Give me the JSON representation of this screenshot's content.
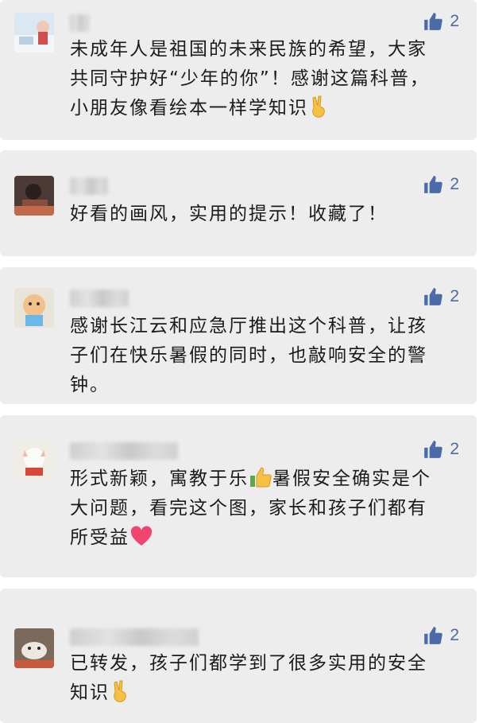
{
  "comments": [
    {
      "like_count": "2",
      "lines": [
        "未成年人是祖国的未来民族的希望，大家",
        "共同守护好“少年的你”！感谢这篇科普，",
        "小朋友像看绘本一样学知识"
      ],
      "trailing_emoji": "victory-hand-emoji"
    },
    {
      "like_count": "2",
      "lines": [
        "好看的画风，实用的提示！收藏了！"
      ]
    },
    {
      "like_count": "2",
      "lines": [
        "感谢长江云和应急厅推出这个科普，让孩",
        "子们在快乐暑假的同时，也敲响安全的警",
        "钟。"
      ]
    },
    {
      "like_count": "2",
      "line1_before": "形式新颖，寓教于乐",
      "line1_after": "暑假安全确实是个",
      "lines_rest": [
        "大问题，看完这个图，家长和孩子们都有"
      ],
      "line3": "所受益",
      "inline_emoji": "thumbs-up-emoji",
      "trailing_emoji": "heart-emoji"
    },
    {
      "like_count": "2",
      "lines": [
        "已转发，孩子们都学到了很多实用的安全",
        "知识"
      ],
      "trailing_emoji": "victory-hand-emoji"
    }
  ],
  "colors": {
    "card_bg": "#ededed",
    "like_blue": "#4a6aa8",
    "text": "#1b1b1b"
  }
}
